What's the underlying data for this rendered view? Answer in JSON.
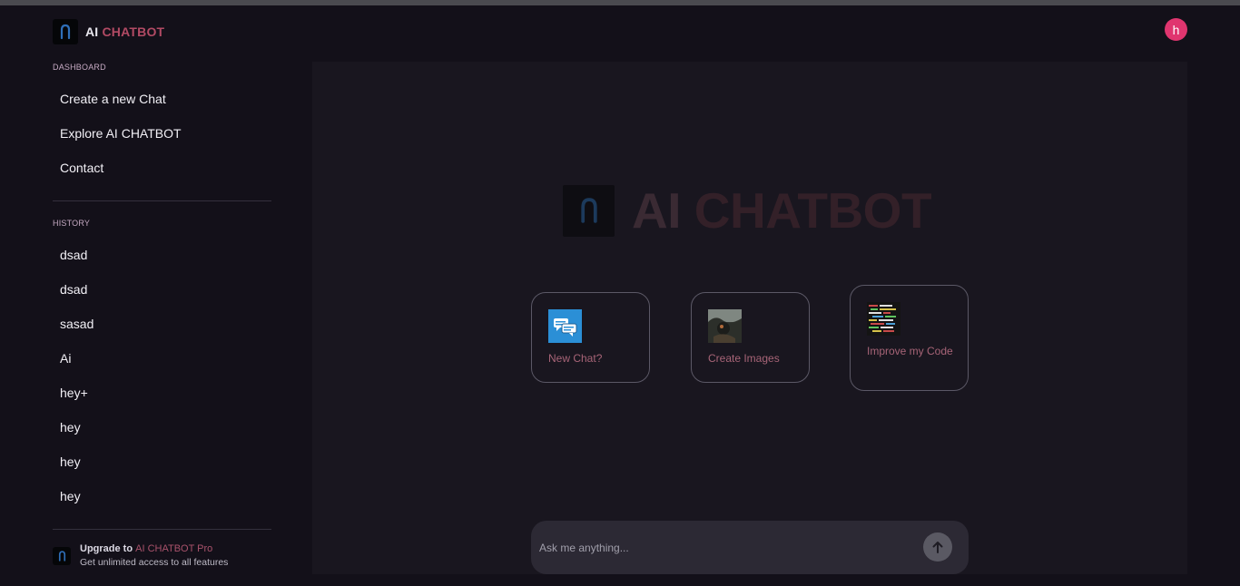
{
  "sidebar": {
    "brand": {
      "ai": "AI",
      "chatbot": "CHATBOT"
    },
    "dashboard_label": "DASHBOARD",
    "dashboard_items": [
      {
        "label": "Create a new Chat"
      },
      {
        "label": "Explore AI CHATBOT"
      },
      {
        "label": "Contact"
      }
    ],
    "history_label": "HISTORY",
    "history_items": [
      {
        "label": "dsad"
      },
      {
        "label": "dsad"
      },
      {
        "label": "sasad"
      },
      {
        "label": "Ai"
      },
      {
        "label": "hey+"
      },
      {
        "label": "hey"
      },
      {
        "label": "hey"
      },
      {
        "label": "hey"
      }
    ],
    "upgrade": {
      "prefix": "Upgrade to",
      "pro": "AI CHATBOT Pro",
      "subtitle": "Get unlimited access to all features"
    }
  },
  "header": {
    "avatar_initial": "h"
  },
  "main": {
    "hero": {
      "ai": "AI",
      "chatbot": "CHATBOT"
    },
    "cards": [
      {
        "label": "New Chat?",
        "icon": "chat-bubbles-icon"
      },
      {
        "label": "Create Images",
        "icon": "image-thumbnail-icon"
      },
      {
        "label": "Improve my Code",
        "icon": "code-thumbnail-icon"
      }
    ],
    "input": {
      "placeholder": "Ask me anything..."
    }
  },
  "colors": {
    "background": "#131019",
    "panel": "#19161f",
    "brand_accent": "#b24a64",
    "avatar": "#e0356f",
    "logo_blue": "#2f6fb8"
  }
}
